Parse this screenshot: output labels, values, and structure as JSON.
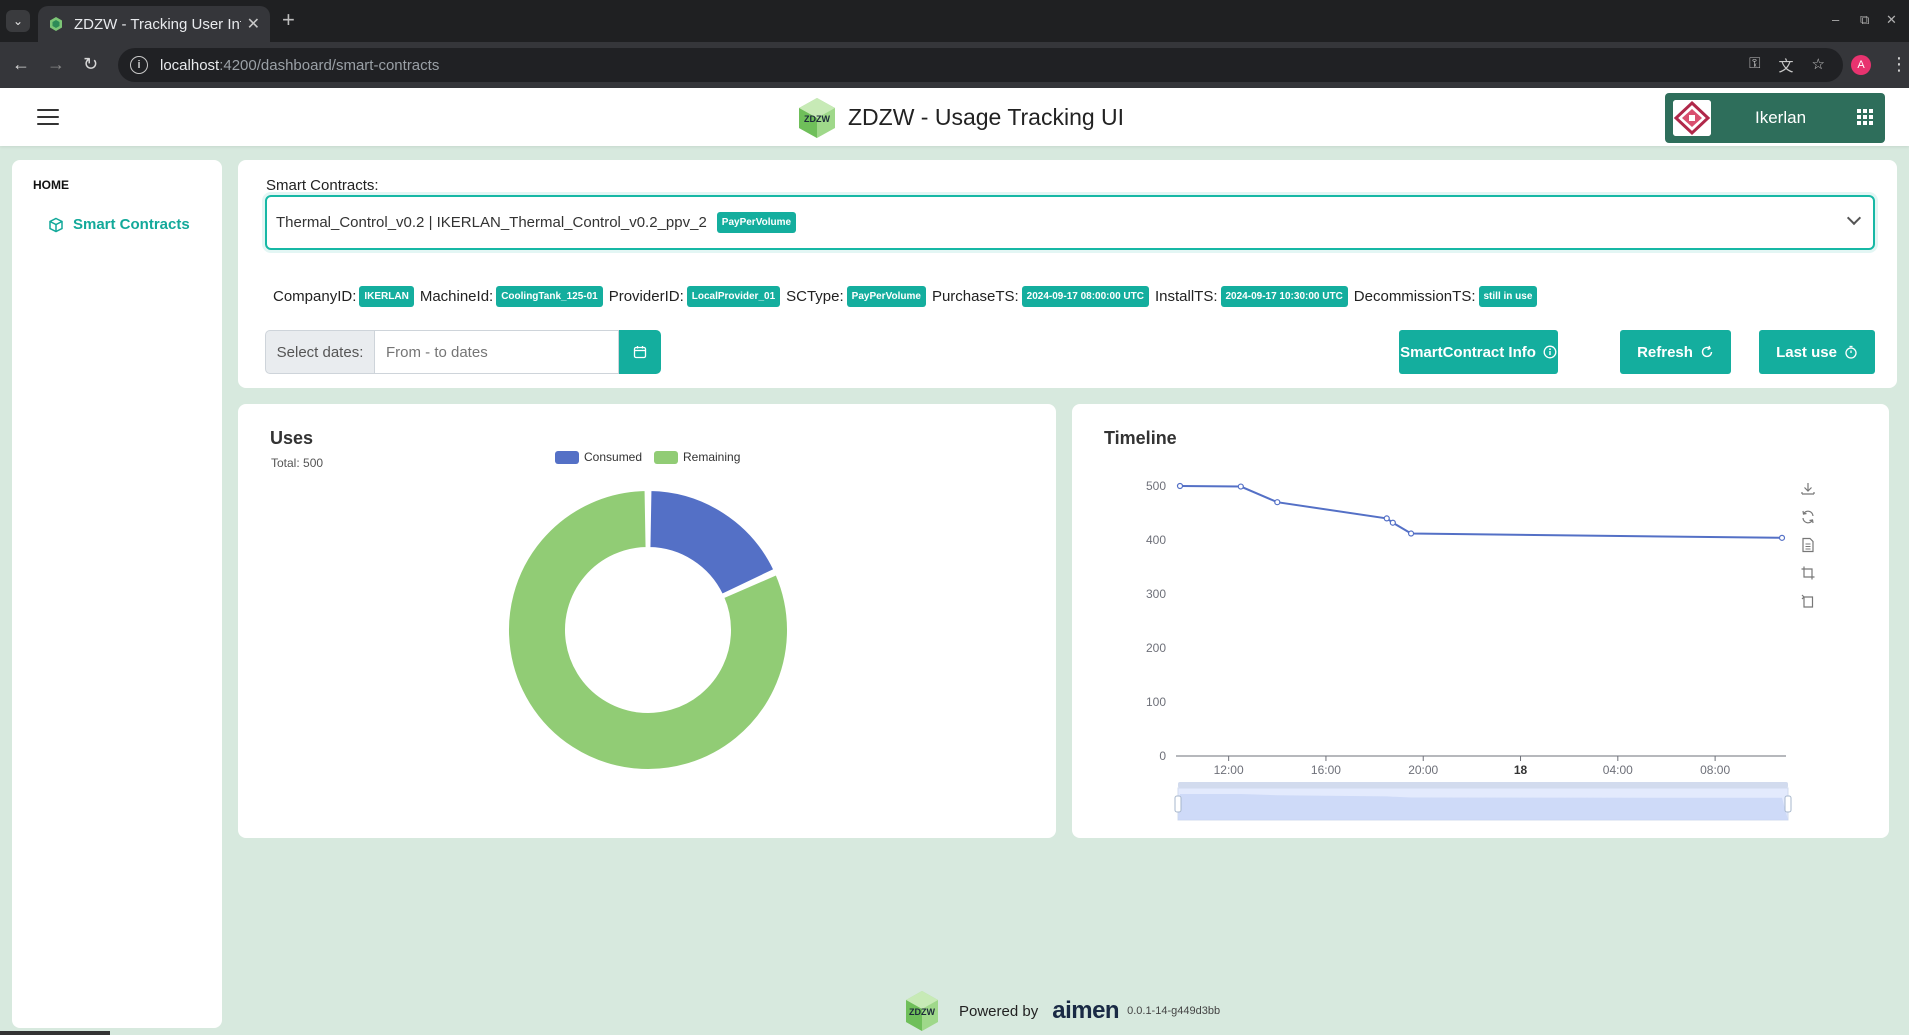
{
  "browser": {
    "tab_title": "ZDZW - Tracking User Int",
    "url_host": "localhost",
    "url_path": ":4200/dashboard/smart-contracts",
    "profile_initial": "A"
  },
  "header": {
    "title": "ZDZW - Usage Tracking UI",
    "logo_text": "ZDZW",
    "org_name": "Ikerlan"
  },
  "sidebar": {
    "section": "HOME",
    "items": [
      {
        "label": "Smart Contracts",
        "icon": "cube-icon"
      }
    ]
  },
  "contract": {
    "label": "Smart Contracts:",
    "selected": "Thermal_Control_v0.2 | IKERLAN_Thermal_Control_v0.2_ppv_2",
    "selected_badge": "PayPerVolume",
    "meta": [
      {
        "label": "CompanyID:",
        "value": "IKERLAN"
      },
      {
        "label": "MachineId:",
        "value": "CoolingTank_125-01"
      },
      {
        "label": "ProviderID:",
        "value": "LocalProvider_01"
      },
      {
        "label": "SCType:",
        "value": "PayPerVolume"
      },
      {
        "label": "PurchaseTS:",
        "value": "2024-09-17 08:00:00 UTC"
      },
      {
        "label": "InstallTS:",
        "value": "2024-09-17 10:30:00 UTC"
      },
      {
        "label": "DecommissionTS:",
        "value": "still in use"
      }
    ],
    "date_prefix": "Select dates:",
    "date_placeholder": "From - to dates",
    "buttons": {
      "info": "SmartContract Info",
      "refresh": "Refresh",
      "last_use": "Last use"
    }
  },
  "uses": {
    "title": "Uses",
    "total_label": "Total: 500",
    "legend": [
      {
        "name": "Consumed",
        "color": "#5470c6"
      },
      {
        "name": "Remaining",
        "color": "#91cc75"
      }
    ]
  },
  "timeline": {
    "title": "Timeline",
    "toolbox": [
      "download-icon",
      "restore-icon",
      "data-view-icon",
      "zoom-icon",
      "zoom-reset-icon"
    ]
  },
  "chart_data": [
    {
      "type": "pie",
      "title": "Uses",
      "subtitle": "Total: 500",
      "donut": true,
      "legend_position": "top",
      "labels": [
        "Consumed",
        "Remaining"
      ],
      "values": [
        91,
        409
      ],
      "colors": [
        "#5470c6",
        "#91cc75"
      ]
    },
    {
      "type": "line",
      "title": "Timeline",
      "x_type": "time",
      "xticks": [
        "12:00",
        "16:00",
        "20:00",
        "18",
        "04:00",
        "08:00"
      ],
      "yticks": [
        0,
        100,
        200,
        300,
        400,
        500
      ],
      "ylim": [
        0,
        500
      ],
      "grid": false,
      "series": [
        {
          "color": "#5470c6",
          "x": [
            "2024-09-17 10:00",
            "2024-09-17 12:30",
            "2024-09-17 14:00",
            "2024-09-17 18:30",
            "2024-09-17 18:45",
            "2024-09-17 19:30",
            "2024-09-18 10:45"
          ],
          "y": [
            500,
            499,
            470,
            440,
            432,
            412,
            404
          ]
        }
      ],
      "data_zoom_slider": true
    }
  ]
}
